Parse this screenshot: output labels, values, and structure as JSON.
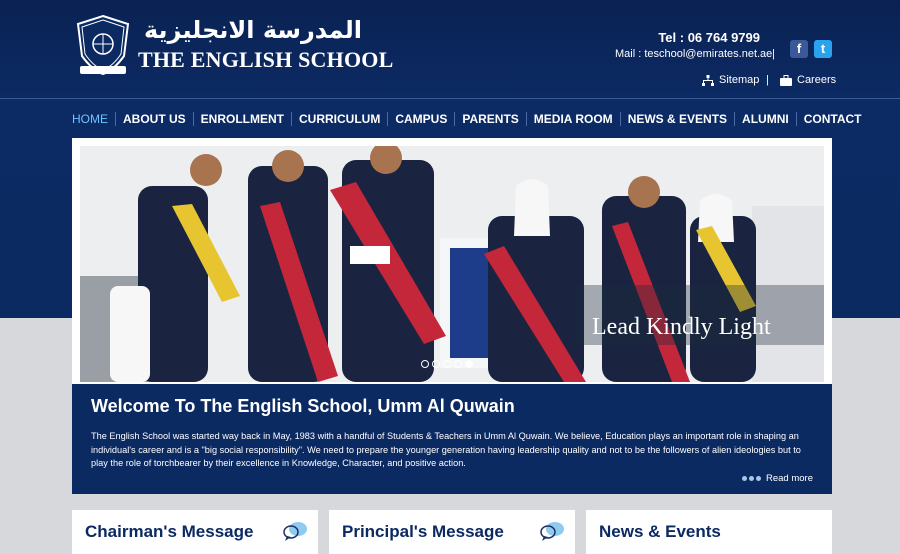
{
  "school": {
    "name_arabic": "المدرسة الانجليزية",
    "name_english": "THE ENGLISH SCHOOL"
  },
  "contact": {
    "tel": "Tel : 06 764 9799",
    "mail": "Mail : teschool@emirates.net.ae",
    "separator": "|"
  },
  "social": {
    "facebook_glyph": "f",
    "twitter_glyph": "t"
  },
  "utility_links": {
    "sitemap": "Sitemap",
    "careers": "Careers",
    "separator": "|"
  },
  "nav": {
    "items": [
      "HOME",
      "ABOUT US",
      "ENROLLMENT",
      "CURRICULUM",
      "CAMPUS",
      "PARENTS",
      "MEDIA ROOM",
      "NEWS & EVENTS",
      "ALUMNI",
      "CONTACT"
    ],
    "active_index": 0
  },
  "slider": {
    "caption": "Lead Kindly Light",
    "dot_count": 5,
    "active_dot": 4
  },
  "welcome": {
    "title": "Welcome To The English School, Umm Al Quwain",
    "body": "The English School was started way back in May, 1983 with a handful of Students & Teachers in Umm Al Quwain. We believe, Education plays an important role in shaping an individual's career and is a \"big social responsibility\". We need to prepare the younger generation having leadership quality and not to be the followers of alien ideologies but to play the role of torchbearer by their excellence in Knowledge, Character, and positive action.",
    "read_more": "Read more"
  },
  "cards": [
    {
      "title": "Chairman's Message"
    },
    {
      "title": "Principal's Message"
    },
    {
      "title": "News & Events"
    }
  ],
  "colors": {
    "brand_navy": "#0b2a62",
    "nav_active": "#6fc3ff",
    "facebook": "#3b5998",
    "twitter": "#2aa3ef"
  }
}
